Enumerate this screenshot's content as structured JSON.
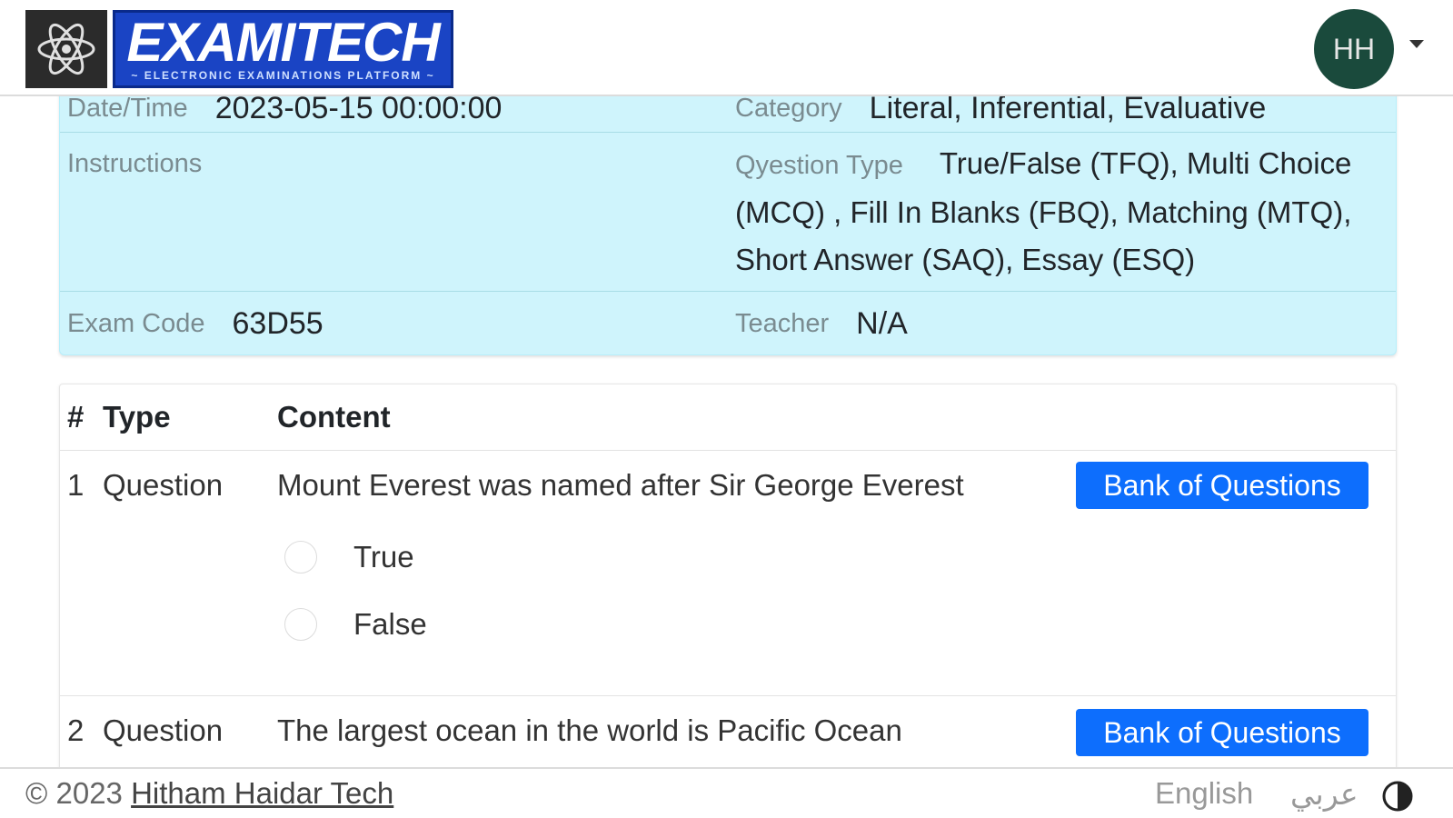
{
  "header": {
    "logo_title": "EXAMITECH",
    "logo_subtitle": "~ ELECTRONIC EXAMINATIONS PLATFORM ~",
    "avatar_initials": "HH"
  },
  "exam_info": {
    "date_label": "Date/Time",
    "date_value": "2023-05-15 00:00:00",
    "category_label": "Category",
    "category_value": "Literal, Inferential, Evaluative",
    "instructions_label": "Instructions",
    "instructions_value": "",
    "question_type_label": "Qyestion Type",
    "question_type_value": "True/False (TFQ), Multi Choice (MCQ) , Fill In Blanks (FBQ), Matching (MTQ), Short Answer (SAQ), Essay (ESQ)",
    "exam_code_label": "Exam Code",
    "exam_code_value": "63D55",
    "teacher_label": "Teacher",
    "teacher_value": "N/A"
  },
  "table": {
    "headers": [
      "#",
      "Type",
      "Content"
    ],
    "rows": [
      {
        "num": "1",
        "type": "Question",
        "content": "Mount Everest was named after Sir George Everest",
        "button": "Bank of Questions",
        "options": [
          "True",
          "False"
        ]
      },
      {
        "num": "2",
        "type": "Question",
        "content": "The largest ocean in the world is Pacific Ocean",
        "button": "Bank of Questions"
      }
    ]
  },
  "footer": {
    "copyright_prefix": "© 2023",
    "copyright_link": "Hitham Haidar Tech",
    "lang_en": "English",
    "lang_ar": "عربي"
  },
  "colors": {
    "info_bg": "#cff4fc",
    "primary": "#0d6efd",
    "avatar_bg": "#1a4a3c",
    "logo_blue": "#1a44c4"
  }
}
